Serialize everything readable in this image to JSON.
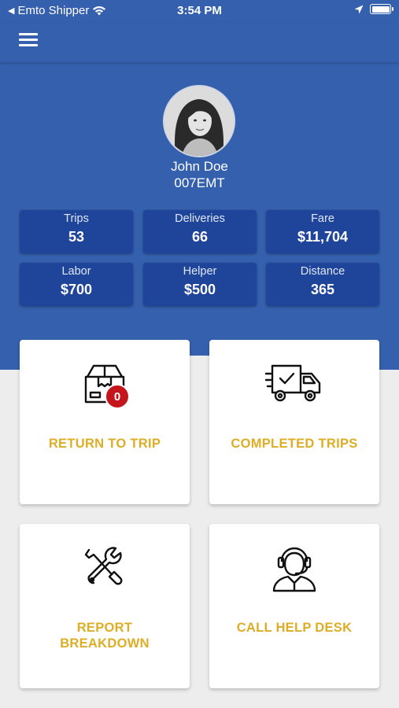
{
  "status_bar": {
    "back_app": "Emto Shipper",
    "time": "3:54 PM"
  },
  "icons": {
    "menu": "hamburger-menu-icon",
    "avatar": "profile-photo",
    "return_to_trip": "package-box-icon",
    "completed_trips": "delivery-truck-check-icon",
    "report_breakdown": "wrench-screwdriver-icon",
    "call_help_desk": "headset-agent-icon"
  },
  "profile": {
    "name": "John Doe",
    "id": "007EMT"
  },
  "stats": [
    {
      "label": "Trips",
      "value": "53"
    },
    {
      "label": "Deliveries",
      "value": "66"
    },
    {
      "label": "Fare",
      "value": "$11,704"
    },
    {
      "label": "Labor",
      "value": "$700"
    },
    {
      "label": "Helper",
      "value": "$500"
    },
    {
      "label": "Distance",
      "value": "365"
    }
  ],
  "cards": {
    "return_to_trip": {
      "label": "RETURN TO TRIP",
      "badge": "0"
    },
    "completed_trips": {
      "label": "COMPLETED TRIPS"
    },
    "report_breakdown": {
      "line1": "REPORT",
      "line2": "BREAKDOWN"
    },
    "call_help_desk": {
      "label": "CALL HELP DESK"
    }
  },
  "colors": {
    "primary": "#3560ad",
    "stat_tile": "#1f459a",
    "accent_label": "#ddae25",
    "badge": "#c4151c",
    "background": "#ededed"
  }
}
